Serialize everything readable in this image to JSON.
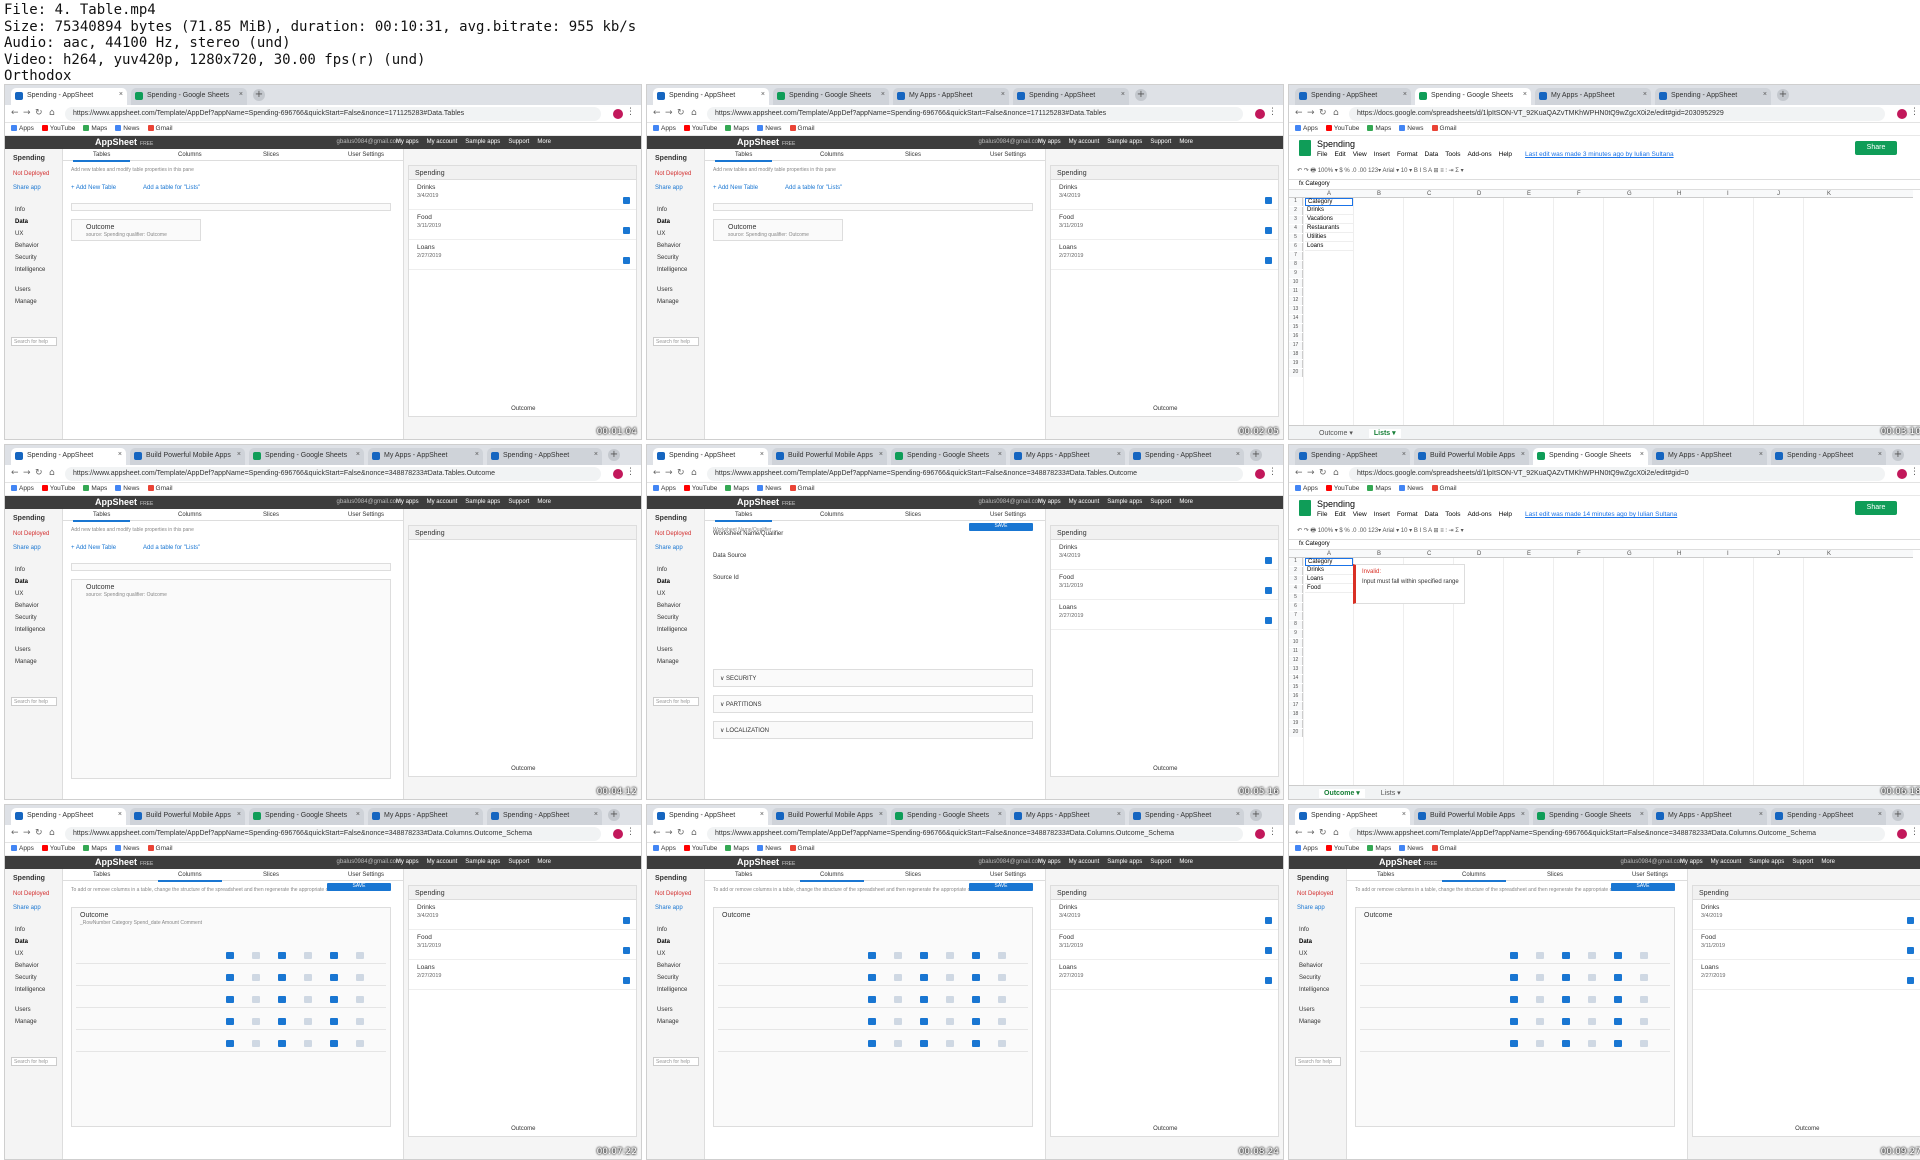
{
  "header": {
    "lines": [
      "File: 4. Table.mp4",
      "Size: 75340894 bytes (71.85 MiB), duration: 00:10:31, avg.bitrate: 955 kb/s",
      "Audio: aac, 44100 Hz, stereo (und)",
      "Video: h264, yuv420p, 1280x720, 30.00 fps(r) (und)",
      "Orthodox"
    ]
  },
  "common": {
    "bookmarks": [
      "Apps",
      "YouTube",
      "Maps",
      "News",
      "Gmail"
    ],
    "appsheet_logo": "AppSheet",
    "appsheet_free": "FREE",
    "email": "gbalus0984@gmail.com",
    "menu": [
      "My apps",
      "My account",
      "Sample apps",
      "Support",
      "More"
    ],
    "app_name": "Spending",
    "not_deployed": "Not Deployed",
    "share_app": "Share app",
    "nav": [
      "Info",
      "Data",
      "UX",
      "Behavior",
      "Security",
      "Intelligence",
      "Users",
      "Manage"
    ],
    "search_help": "Search for help",
    "content_tabs": [
      "Tables",
      "Columns",
      "Slices",
      "User Settings"
    ],
    "preview_title": "Spending",
    "preview_rows": [
      {
        "title": "Drinks",
        "date": "3/4/2019"
      },
      {
        "title": "Food",
        "date": "3/11/2019"
      },
      {
        "title": "Loans",
        "date": "2/27/2019"
      }
    ],
    "preview_footer": "Outcome"
  },
  "thumbs": [
    {
      "kind": "appsheet",
      "tabs": [
        "Spending - AppSheet",
        "Spending - Google Sheets"
      ],
      "url": "https://www.appsheet.com/Template/AppDef?appName=Spending-696766&quickStart=False&nonce=171125283#Data.Tables",
      "hint": "Add new tables and modify table properties in this pane",
      "add_table": "Add New Table",
      "add_lists": "Add a table for \"Lists\"",
      "table_name": "Outcome",
      "table_sub": "source: Spending  qualifier: Outcome",
      "timecode": "00:01:04"
    },
    {
      "kind": "appsheet",
      "tabs": [
        "Spending - AppSheet",
        "Spending - Google Sheets",
        "My Apps - AppSheet",
        "Spending - AppSheet"
      ],
      "url": "https://www.appsheet.com/Template/AppDef?appName=Spending-696766&quickStart=False&nonce=171125283#Data.Tables",
      "hint": "Add new tables and modify table properties in this pane",
      "add_table": "Add New Table",
      "add_lists": "Add a table for \"Lists\"",
      "table_name": "Outcome",
      "table_sub": "source: Spending  qualifier: Outcome",
      "timecode": "00:02:05"
    },
    {
      "kind": "sheets",
      "tabs": [
        "Spending - AppSheet",
        "Spending - Google Sheets",
        "My Apps - AppSheet",
        "Spending - AppSheet"
      ],
      "url": "https://docs.google.com/spreadsheets/d/1lpItSON-VT_92KuaQAZvTMKhWPHN0tQ9wZgcX0i2e/edit#gid=2030952929",
      "title": "Spending",
      "menu": [
        "File",
        "Edit",
        "View",
        "Insert",
        "Format",
        "Data",
        "Tools",
        "Add-ons",
        "Help"
      ],
      "last_edit": "Last edit was made 3 minutes ago by Iulian Sultana",
      "share": "Share",
      "fx": "Category",
      "cells": [
        "Category",
        "Drinks",
        "Vacations",
        "Restaurants",
        "Utilities",
        "Loans"
      ],
      "sheet_tabs": [
        "Outcome",
        "Lists"
      ],
      "active_sheet": "Lists",
      "timecode": "00:03:10"
    },
    {
      "kind": "appsheet",
      "tabs": [
        "Spending - AppSheet",
        "Build Powerful Mobile Apps",
        "Spending - Google Sheets",
        "My Apps - AppSheet",
        "Spending - AppSheet"
      ],
      "url": "https://www.appsheet.com/Template/AppDef?appName=Spending-696766&quickStart=False&nonce=348878233#Data.Tables.Outcome",
      "hint": "Add new tables and modify table properties in this pane",
      "add_table": "Add New Table",
      "add_lists": "Add a table for \"Lists\"",
      "table_name": "Outcome",
      "table_sub": "source: Spending  qualifier: Outcome",
      "timecode": "00:04:12"
    },
    {
      "kind": "appsheet",
      "tabs": [
        "Spending - AppSheet",
        "Build Powerful Mobile Apps",
        "Spending - Google Sheets",
        "My Apps - AppSheet",
        "Spending - AppSheet"
      ],
      "url": "https://www.appsheet.com/Template/AppDef?appName=Spending-696766&quickStart=False&nonce=348878233#Data.Tables.Outcome",
      "hint": "Worksheet Name/Qualifier",
      "add_table": "SECURITY",
      "add_lists": "PARTITIONS",
      "table_name": "Outcome",
      "table_sub": "LOCALIZATION",
      "timecode": "00:05:16"
    },
    {
      "kind": "sheets",
      "tabs": [
        "Spending - AppSheet",
        "Build Powerful Mobile Apps",
        "Spending - Google Sheets",
        "My Apps - AppSheet",
        "Spending - AppSheet"
      ],
      "url": "https://docs.google.com/spreadsheets/d/1lpItSON-VT_92KuaQAZvTMKhWPHN0tQ9wZgcX0i2e/edit#gid=0",
      "title": "Spending",
      "menu": [
        "File",
        "Edit",
        "View",
        "Insert",
        "Format",
        "Data",
        "Tools",
        "Add-ons",
        "Help"
      ],
      "last_edit": "Last edit was made 14 minutes ago by Iulian Sultana",
      "share": "Share",
      "fx": "Category",
      "cells": [
        "Category",
        "Drinks",
        "Loans",
        "Food",
        "",
        ""
      ],
      "sheet_tabs": [
        "Outcome",
        "Lists"
      ],
      "active_sheet": "Outcome",
      "invalid_title": "Invalid:",
      "invalid_text": "Input must fall within specified range",
      "timecode": "00:06:18"
    },
    {
      "kind": "appsheet",
      "tabs": [
        "Spending - AppSheet",
        "Build Powerful Mobile Apps",
        "Spending - Google Sheets",
        "My Apps - AppSheet",
        "Spending - AppSheet"
      ],
      "url": "https://www.appsheet.com/Template/AppDef?appName=Spending-696766&quickStart=False&nonce=348878233#Data.Columns.Outcome_Schema",
      "hint": "To add or remove columns in a table, change the structure of the spreadsheet and then regenerate the appropriate column structure.",
      "add_table": "",
      "add_lists": "",
      "table_name": "Outcome",
      "table_sub": "_RowNumber   Category   Spend_date   Amount   Comment",
      "timecode": "00:07:22"
    },
    {
      "kind": "appsheet",
      "tabs": [
        "Spending - AppSheet",
        "Build Powerful Mobile Apps",
        "Spending - Google Sheets",
        "My Apps - AppSheet",
        "Spending - AppSheet"
      ],
      "url": "https://www.appsheet.com/Template/AppDef?appName=Spending-696766&quickStart=False&nonce=348878233#Data.Columns.Outcome_Schema",
      "hint": "To add or remove columns in a table, change the structure of the spreadsheet and then regenerate the appropriate column structure.",
      "add_table": "",
      "add_lists": "",
      "table_name": "Outcome",
      "table_sub": "",
      "timecode": "00:08:24"
    },
    {
      "kind": "appsheet",
      "tabs": [
        "Spending - AppSheet",
        "Build Powerful Mobile Apps",
        "Spending - Google Sheets",
        "My Apps - AppSheet",
        "Spending - AppSheet"
      ],
      "url": "https://www.appsheet.com/Template/AppDef?appName=Spending-696766&quickStart=False&nonce=348878233#Data.Columns.Outcome_Schema",
      "hint": "To add or remove columns in a table, change the structure of the spreadsheet and then regenerate the appropriate column structure.",
      "add_table": "",
      "add_lists": "",
      "table_name": "Outcome",
      "table_sub": "",
      "timecode": "00:09:27"
    }
  ]
}
